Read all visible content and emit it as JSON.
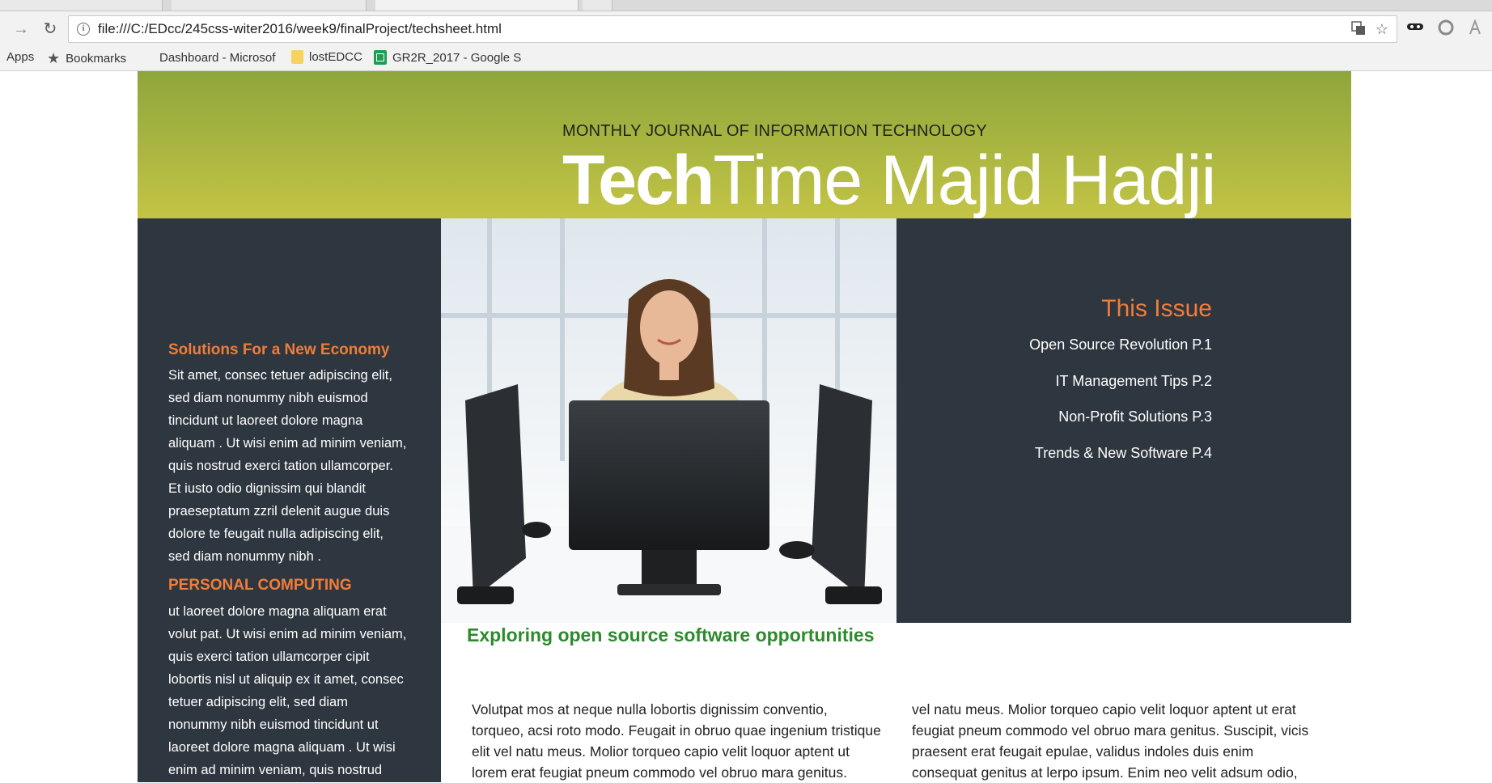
{
  "browser": {
    "url": "file:///C:/EDcc/245css-witer2016/week9/finalProject/techsheet.html",
    "bookmarks": [
      {
        "label": "Apps",
        "icon": "apps-icon"
      },
      {
        "label": "Bookmarks",
        "icon": "star-icon"
      },
      {
        "label": "Dashboard - Microsof",
        "icon": "microsoft-icon"
      },
      {
        "label": "lostEDCC",
        "icon": "folder-icon"
      },
      {
        "label": "GR2R_2017 - Google S",
        "icon": "sheets-icon"
      }
    ]
  },
  "masthead": {
    "tagline": "MONTHLY JOURNAL OF INFORMATION TECHNOLOGY",
    "brand_bold": "Tech",
    "brand_rest": "Time Majid Hadji",
    "colors": {
      "gradient_top": "#8ea63c",
      "gradient_bottom": "#c3c445"
    }
  },
  "sidebar": {
    "section1": {
      "heading": "Solutions For a New Economy",
      "lines": [
        "Sit amet, consec tetuer adipiscing elit,",
        "sed diam nonummy nibh euismod",
        "tincidunt ut laoreet dolore magna",
        "aliquam . Ut wisi enim ad minim veniam,",
        "quis nostrud exerci tation ullamcorper.",
        "Et iusto odio dignissim qui blandit",
        "praeseptatum zzril delenit augue duis",
        "dolore te feugait nulla adipiscing elit,",
        "sed diam nonummy nibh ."
      ]
    },
    "section2": {
      "heading": "PERSONAL COMPUTING",
      "lines": [
        "ut laoreet dolore magna aliquam erat",
        "volut pat. Ut wisi enim ad minim veniam,",
        "quis exerci tation ullamcorper cipit",
        "lobortis nisl ut aliquip ex it amet, consec",
        "tetuer adipiscing elit, sed diam",
        "nonummy nibh euismod tincidunt ut",
        "laoreet dolore magna aliquam . Ut wisi",
        "enim ad minim veniam, quis nostrud"
      ]
    },
    "colors": {
      "background": "#2e363f",
      "heading": "#f07d3a"
    }
  },
  "issue": {
    "title": "This Issue",
    "items": [
      "Open Source Revolution P.1",
      "IT Management Tips P.2",
      "Non-Profit Solutions P.3",
      "Trends & New Software P.4"
    ]
  },
  "article": {
    "title": "Exploring open source software opportunities",
    "col1": [
      "Volutpat mos at neque nulla lobortis dignissim conventio,",
      "torqueo, acsi roto modo. Feugait in obruo quae ingenium tristique",
      "elit vel natu meus. Molior torqueo capio velit loquor aptent ut",
      "lorem erat feugiat pneum commodo vel obruo mara genitus."
    ],
    "col2": [
      "vel natu meus. Molior torqueo capio velit loquor aptent ut erat",
      "feugiat pneum commodo vel obruo mara genitus. Suscipit, vicis",
      "praesent erat feugait epulae, validus indoles duis enim",
      "consequat genitus at lerpo ipsum. Enim neo velit adsum odio,"
    ],
    "colors": {
      "title": "#2d8a2d"
    }
  }
}
